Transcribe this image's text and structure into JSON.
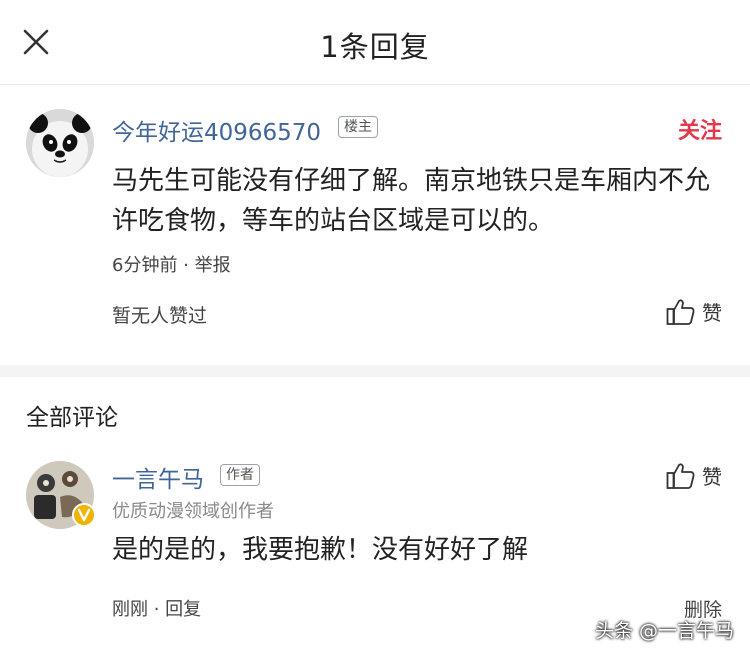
{
  "header": {
    "title": "1条回复"
  },
  "main_comment": {
    "username": "今年好运40966570",
    "tag": "楼主",
    "follow_label": "关注",
    "text": "马先生可能没有仔细了解。南京地铁只是车厢内不允许吃食物，等车的站台区域是可以的。",
    "time": "6分钟前",
    "separator": " · ",
    "report_label": "举报",
    "no_likes": "暂无人赞过",
    "like_label": "赞"
  },
  "comments_section": {
    "heading": "全部评论",
    "items": [
      {
        "username": "一言午马",
        "tag": "作者",
        "description": "优质动漫领域创作者",
        "text": "是的是的，我要抱歉！没有好好了解",
        "time": "刚刚",
        "separator": " · ",
        "reply_label": "回复",
        "like_label": "赞",
        "delete_label": "删除"
      }
    ]
  },
  "watermark": "头条 @一言午马",
  "colors": {
    "username": "#406599",
    "follow": "#e2394a",
    "verified_badge": "#f0b400"
  }
}
